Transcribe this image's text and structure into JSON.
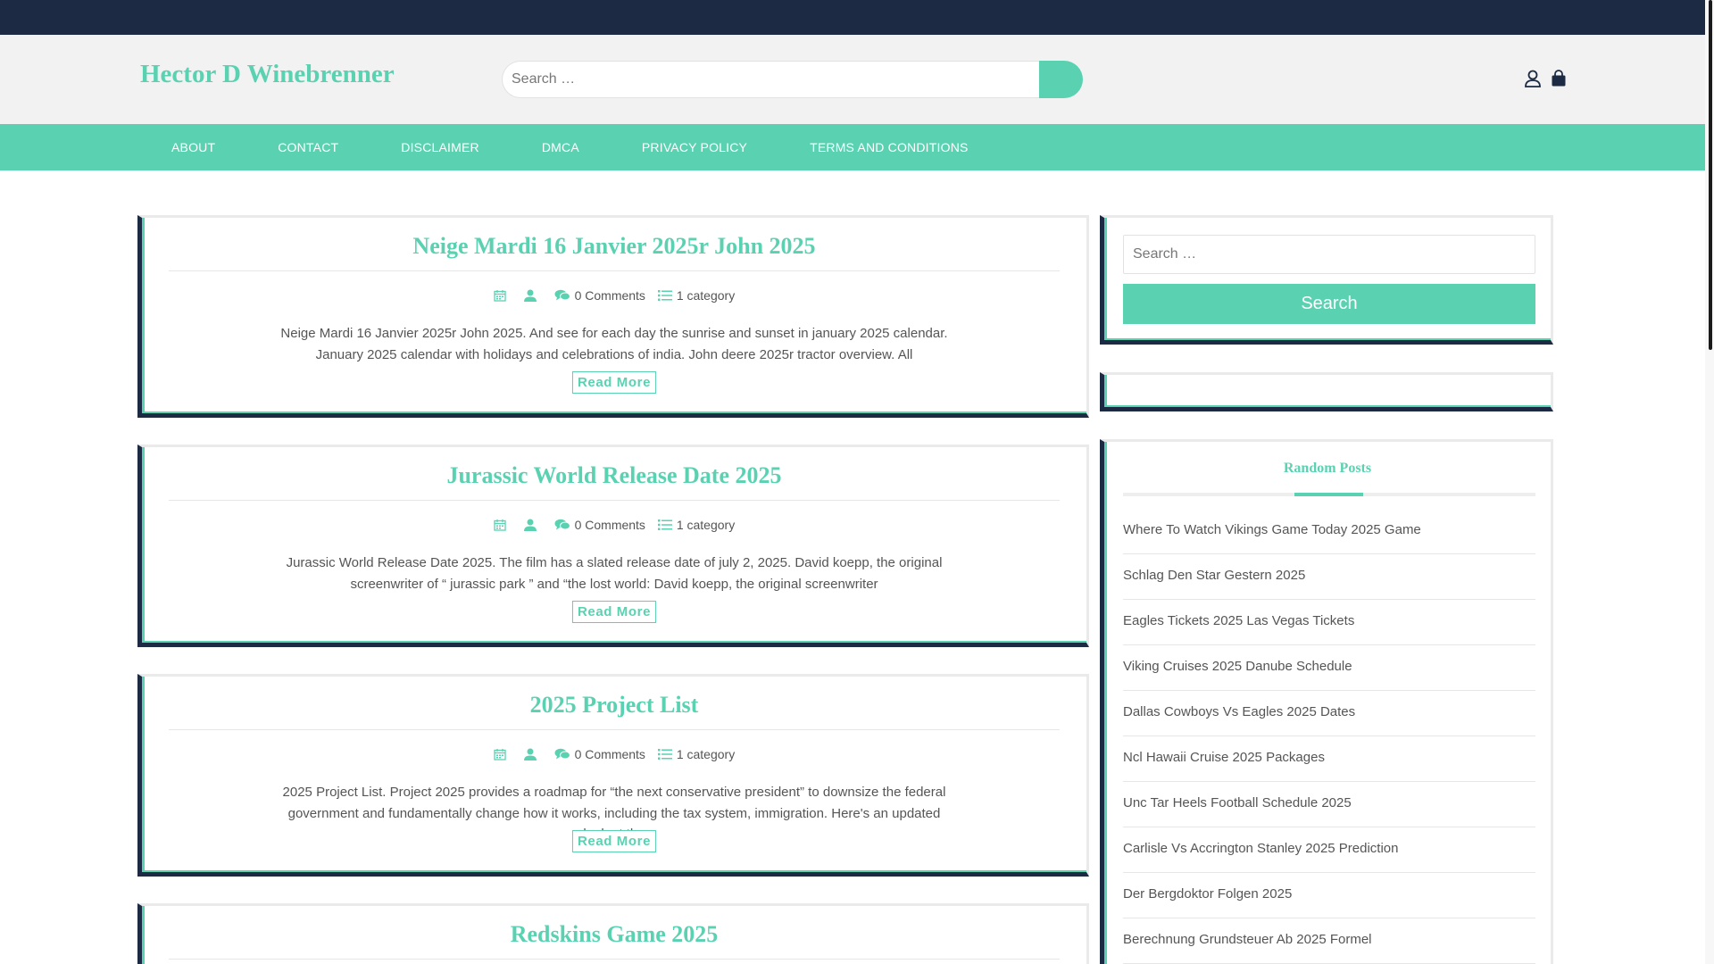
{
  "site": {
    "title": "Hector D Winebrenner"
  },
  "header": {
    "search_placeholder": "Search …",
    "search_icon": "search-icon",
    "account_icon": "user-icon",
    "cart_icon": "shopping-bag-icon"
  },
  "nav": {
    "items": [
      {
        "label": "ABOUT"
      },
      {
        "label": "CONTACT"
      },
      {
        "label": "DISCLAIMER"
      },
      {
        "label": "DMCA"
      },
      {
        "label": "PRIVACY POLICY"
      },
      {
        "label": "TERMS AND CONDITIONS"
      }
    ]
  },
  "posts": [
    {
      "title": "Neige Mardi 16 Janvier 2025r John 2025",
      "comments": "0 Comments",
      "category": "1 category",
      "excerpt": "Neige Mardi 16 Janvier 2025r John 2025. And see for each day the sunrise and sunset in january 2025 calendar. January 2025 calendar with holidays and celebrations of india. John deere 2025r tractor overview. All",
      "read_more": "Read More"
    },
    {
      "title": "Jurassic World Release Date 2025",
      "comments": "0 Comments",
      "category": "1 category",
      "excerpt": "Jurassic World Release Date 2025. The film has a slated release date of july 2, 2025. David koepp, the original screenwriter of “ jurassic park ” and “the lost world: David koepp, the original screenwriter",
      "read_more": "Read More"
    },
    {
      "title": "2025 Project List",
      "comments": "0 Comments",
      "category": "1 category",
      "excerpt": "2025 Project List. Project 2025 provides a roadmap for “the next conservative president” to downsize the federal government and fundamentally change how it works, including the tax system, immigration. Here's an updated look at the",
      "read_more": "Read More"
    },
    {
      "title": "Redskins Game 2025"
    }
  ],
  "sidebar": {
    "search": {
      "placeholder": "Search …",
      "button": "Search"
    },
    "random_posts": {
      "title": "Random Posts",
      "items": [
        "Where To Watch Vikings Game Today 2025 Game",
        "Schlag Den Star Gestern 2025",
        "Eagles Tickets 2025 Las Vegas Tickets",
        "Viking Cruises 2025 Danube Schedule",
        "Dallas Cowboys Vs Eagles 2025 Dates",
        "Ncl Hawaii Cruise 2025 Packages",
        "Unc Tar Heels Football Schedule 2025",
        "Carlisle Vs Accrington Stanley 2025 Prediction",
        "Der Bergdoktor Folgen 2025",
        "Berechnung Grundsteuer Ab 2025 Formel"
      ]
    }
  },
  "colors": {
    "accent": "#5ad2b2",
    "dark": "#1c2a44",
    "header_bg": "#f2f2f2"
  }
}
